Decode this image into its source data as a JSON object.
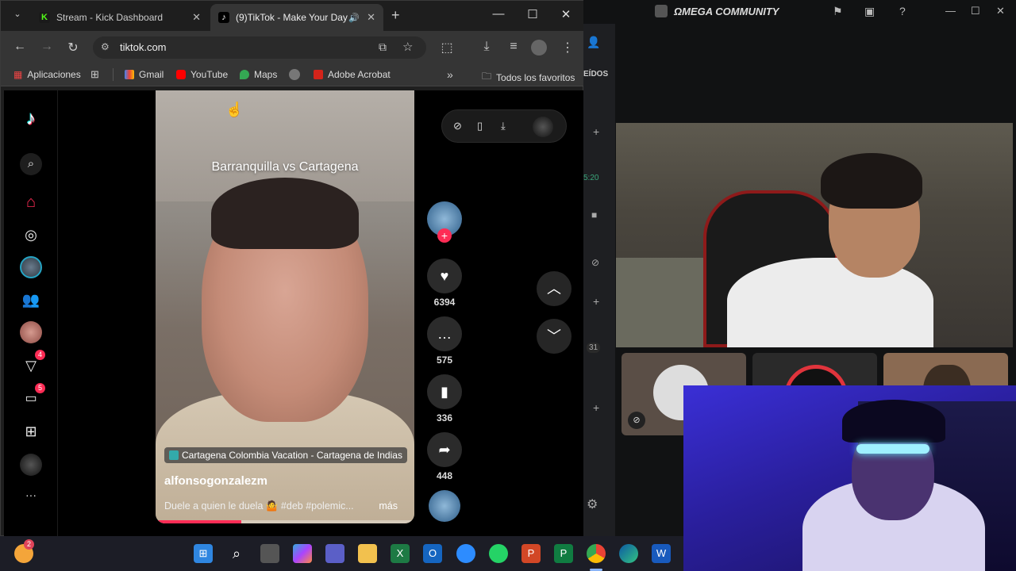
{
  "browser": {
    "tabs": [
      {
        "title": "Stream - Kick Dashboard",
        "favicon": "K"
      },
      {
        "title": "(9)TikTok - Make Your Day",
        "favicon": "♪"
      }
    ],
    "new_tab": "+",
    "url": "tiktok.com",
    "bookmarks": [
      {
        "label": "Aplicaciones"
      },
      {
        "label": "Gmail"
      },
      {
        "label": "YouTube"
      },
      {
        "label": "Maps"
      },
      {
        "label": "Adobe Acrobat"
      }
    ],
    "bookmarks_overflow": "»",
    "all_bookmarks": "Todos los favoritos"
  },
  "tiktok": {
    "nav_badges": {
      "messages_inbox": "4",
      "activity": "5"
    },
    "more": "···",
    "video": {
      "title": "Barranquilla vs Cartagena",
      "location": "Cartagena Colombia Vacation - Cartagena de Indias",
      "author": "alfonsogonzalezm",
      "description": "Duele a quien le duela 🤷 #deb #polemic...",
      "more_label": "más",
      "progress": 0.33
    },
    "actions": {
      "likes": "6394",
      "comments": "575",
      "saves": "336",
      "shares": "448"
    }
  },
  "discord": {
    "title": "ΩMEGA COMMUNITY",
    "side_label": "EÍDOS",
    "time_fragment": "5:20",
    "count_fragment": "31"
  },
  "taskbar": {
    "notification_count": "2"
  },
  "colors": {
    "tiktok_red": "#fe2c55",
    "chrome_dark": "#353535"
  }
}
